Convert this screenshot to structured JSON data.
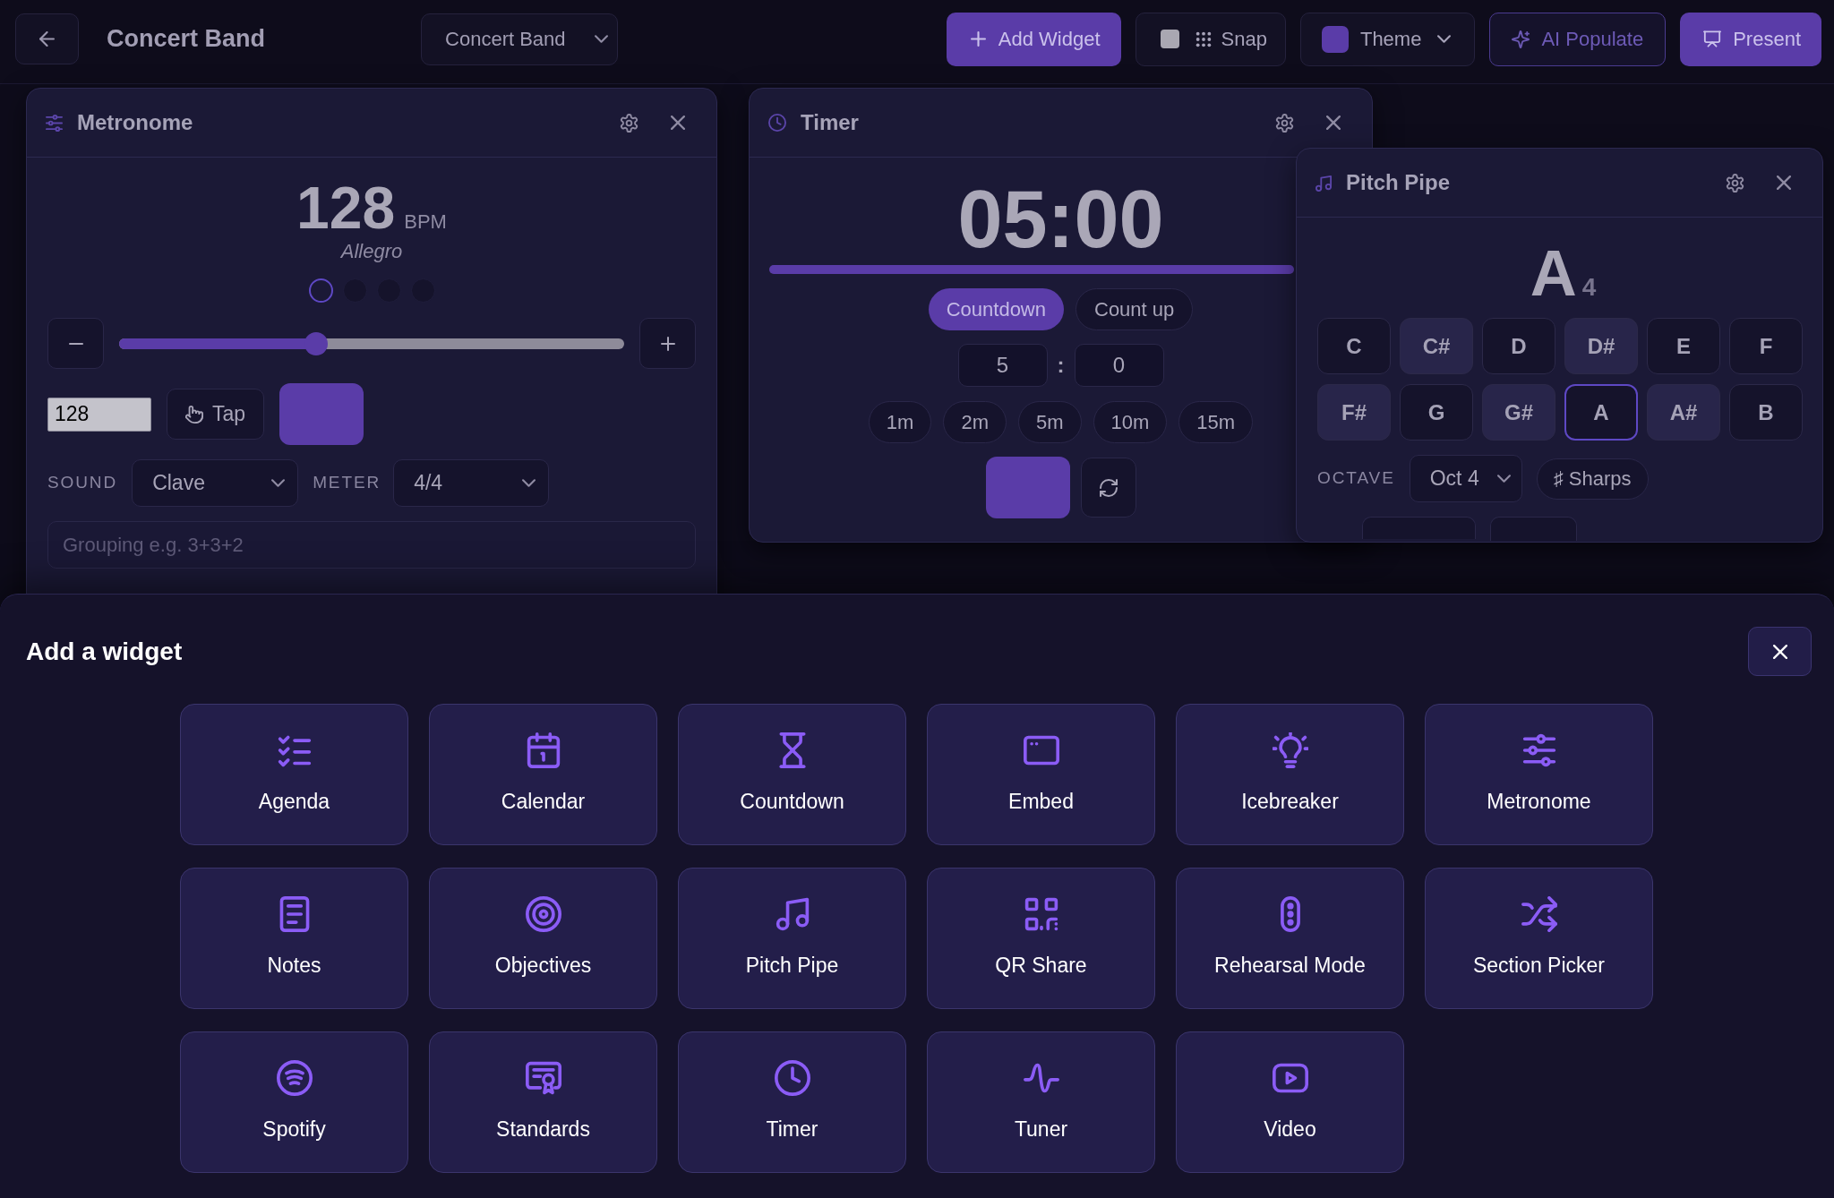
{
  "top_bar": {
    "title": "Concert Band",
    "board_select": "Concert Band",
    "add_widget": "Add Widget",
    "snap": {
      "label": "Snap",
      "checked": false
    },
    "theme": "Theme",
    "ai_populate": "AI Populate",
    "present": "Present"
  },
  "widgets": [
    {
      "kind": "metronome",
      "title": "Metronome",
      "bpm": "128",
      "bpm_unit": "BPM",
      "tempo_name": "Allegro",
      "beats": [
        {
          "active": true
        },
        {
          "active": false
        },
        {
          "active": false
        },
        {
          "active": false
        }
      ],
      "tempo_slider": {
        "level": 0.39
      },
      "bpm_input": "128",
      "tap": "Tap",
      "sound": {
        "label": "SOUND",
        "value": "Clave"
      },
      "meter": {
        "label": "METER",
        "value": "4/4"
      },
      "grouping": {
        "placeholder": "Grouping e.g. 3+3+2"
      }
    },
    {
      "kind": "timer",
      "title": "Timer",
      "display": "05:00",
      "progress": {
        "level": 1
      },
      "modes": [
        {
          "label": "Countdown",
          "selected": true
        },
        {
          "label": "Count up",
          "selected": false
        }
      ],
      "minutes": "5",
      "separator": ":",
      "seconds": "0",
      "presets": [
        "1m",
        "2m",
        "5m",
        "10m",
        "15m"
      ]
    },
    {
      "kind": "pitch_pipe",
      "title": "Pitch Pipe",
      "note": "A",
      "note_octave": "4",
      "keys": [
        {
          "label": "C",
          "kind": "natural",
          "selected": false
        },
        {
          "label": "C#",
          "kind": "sharp",
          "selected": false
        },
        {
          "label": "D",
          "kind": "natural",
          "selected": false
        },
        {
          "label": "D#",
          "kind": "sharp",
          "selected": false
        },
        {
          "label": "E",
          "kind": "natural",
          "selected": false
        },
        {
          "label": "F",
          "kind": "natural",
          "selected": false
        },
        {
          "label": "F#",
          "kind": "sharp",
          "selected": false
        },
        {
          "label": "G",
          "kind": "natural",
          "selected": false
        },
        {
          "label": "G#",
          "kind": "sharp",
          "selected": false
        },
        {
          "label": "A",
          "kind": "natural",
          "selected": true
        },
        {
          "label": "A#",
          "kind": "sharp",
          "selected": false
        },
        {
          "label": "B",
          "kind": "natural",
          "selected": false
        }
      ],
      "octave": {
        "label": "OCTAVE",
        "value": "Oct 4"
      },
      "accidentals": "♯ Sharps"
    }
  ],
  "add_widget_panel": {
    "title": "Add a widget",
    "widgets": [
      "Agenda",
      "Calendar",
      "Countdown",
      "Embed",
      "Icebreaker",
      "Metronome",
      "Notes",
      "Objectives",
      "Pitch Pipe",
      "QR Share",
      "Rehearsal Mode",
      "Section Picker",
      "Spotify",
      "Standards",
      "Timer",
      "Tuner",
      "Video"
    ]
  }
}
